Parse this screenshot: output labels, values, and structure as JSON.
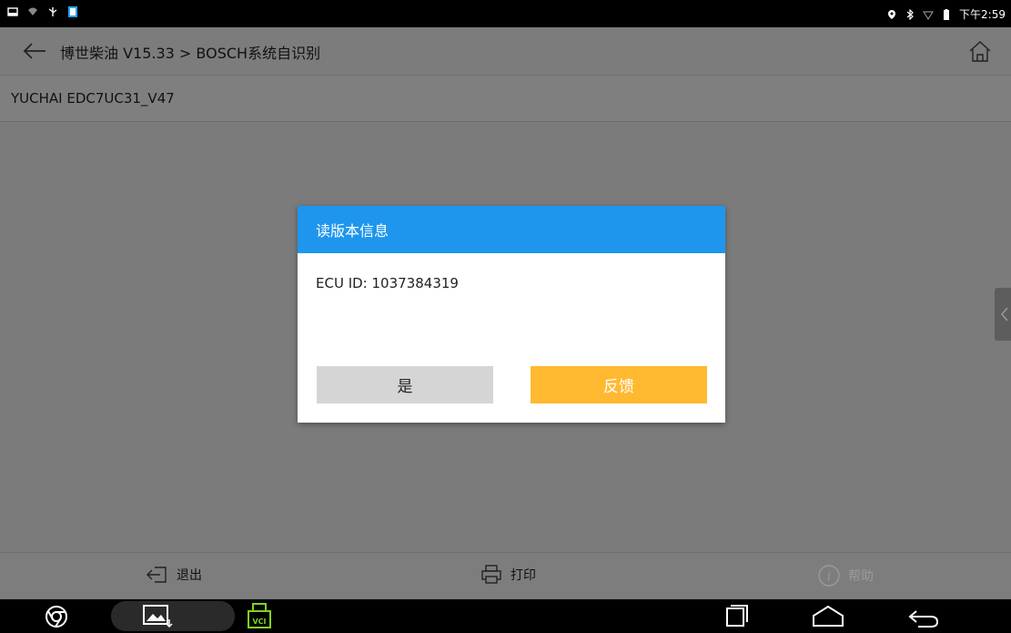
{
  "status_bar": {
    "time": "下午2:59"
  },
  "header": {
    "breadcrumb": "博世柴油 V15.33 > BOSCH系统自识别"
  },
  "subheader": {
    "title": "YUCHAI EDC7UC31_V47"
  },
  "dialog": {
    "title": "读版本信息",
    "label": "ECU ID:",
    "value": "1037384319",
    "yes_label": "是",
    "feedback_label": "反馈"
  },
  "toolbar": {
    "exit_label": "退出",
    "print_label": "打印",
    "help_label": "帮助"
  },
  "navbar": {
    "vci_label": "VCI"
  },
  "colors": {
    "dialog_header": "#1e96ee",
    "feedback_button": "#ffb931",
    "yes_button": "#d5d5d5"
  }
}
